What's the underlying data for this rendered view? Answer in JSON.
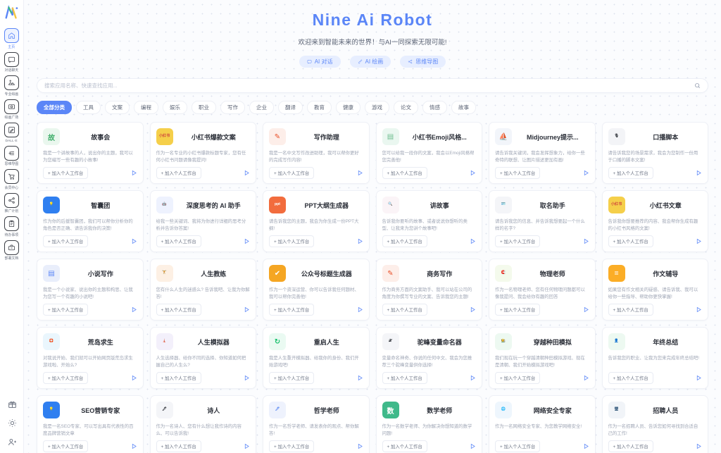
{
  "sidebar": {
    "logo": "nine-ai-logo",
    "items": [
      {
        "label": "主页",
        "icon": "home-icon",
        "active": true
      },
      {
        "label": "对话聊天",
        "icon": "chat-icon",
        "active": false
      },
      {
        "label": "专业绘画",
        "icon": "image-icon",
        "active": false
      },
      {
        "label": "绘画广场",
        "icon": "gallery-icon",
        "active": false
      },
      {
        "label": "DALL·E",
        "icon": "dalle-icon",
        "active": false
      },
      {
        "label": "思维导图",
        "icon": "mindmap-icon",
        "active": false
      },
      {
        "label": "会员中心",
        "icon": "cart-icon",
        "active": false
      },
      {
        "label": "推广计划",
        "icon": "share-icon",
        "active": false
      },
      {
        "label": "待办事项",
        "icon": "clipboard-icon",
        "active": false
      },
      {
        "label": "部署文档",
        "icon": "briefcase-icon",
        "active": false
      }
    ],
    "bottom": [
      {
        "icon": "gift-icon"
      },
      {
        "icon": "sun-icon"
      },
      {
        "icon": "user-add-icon"
      }
    ]
  },
  "hero": {
    "title": "Nine Ai Robot",
    "subtitle": "欢迎来到智能未来的世界！与AI一同探索无限可能!",
    "pills": [
      {
        "label": "AI 对话",
        "icon": "chat-bubble-icon"
      },
      {
        "label": "AI 绘画",
        "icon": "brush-icon"
      },
      {
        "label": "思维导图",
        "icon": "share-nodes-icon"
      }
    ]
  },
  "search": {
    "placeholder": "搜索应用名称、快速查找应用...",
    "value": "",
    "icon": "search-icon"
  },
  "categories": [
    {
      "label": "全部分类",
      "active": true
    },
    {
      "label": "工具",
      "active": false
    },
    {
      "label": "文案",
      "active": false
    },
    {
      "label": "编程",
      "active": false
    },
    {
      "label": "娱乐",
      "active": false
    },
    {
      "label": "职业",
      "active": false
    },
    {
      "label": "写作",
      "active": false
    },
    {
      "label": "企业",
      "active": false
    },
    {
      "label": "翻译",
      "active": false
    },
    {
      "label": "教育",
      "active": false
    },
    {
      "label": "健康",
      "active": false
    },
    {
      "label": "游戏",
      "active": false
    },
    {
      "label": "论文",
      "active": false
    },
    {
      "label": "情感",
      "active": false
    },
    {
      "label": "故事",
      "active": false
    }
  ],
  "card_actions": {
    "add_label": "+ 加入个人工作台",
    "play_icon": "play-icon"
  },
  "apps": [
    {
      "title": "故事会",
      "desc": "我是一个讲故事的人，说出你的主题，我可以为您编写一些有趣的小故事!",
      "icon": "book-icon",
      "glyph": "故",
      "fg": "#3fae6a",
      "bg": "#eaf7ee"
    },
    {
      "title": "小红书爆款文案",
      "desc": "作为一名专业的小红书爆款标题专家，您有任何小红书问题请像我提问!",
      "icon": "xiaohongshu-icon",
      "glyph": "小红书",
      "fg": "#d04a3c",
      "bg": "#f5cf4a"
    },
    {
      "title": "写作助理",
      "desc": "我是一名中文写作改进助理，我可以帮你更好的完成写作内容!",
      "icon": "pencil-doc-icon",
      "glyph": "✎",
      "fg": "#e8502a",
      "bg": "#fdeee9"
    },
    {
      "title": "小红书Emoji风格...",
      "desc": "您可以给我一段你的文案，我会以Emoji风格帮您完善他!",
      "icon": "notebook-icon",
      "glyph": "▤",
      "fg": "#6dbd8e",
      "bg": "#eaf7f0"
    },
    {
      "title": "Midjourney提示...",
      "desc": "请告诉我关键词，我会发挥想象力，给你一些奇特的联想、让图片描述更加有画!",
      "icon": "sailboat-icon",
      "glyph": "⛵",
      "fg": "#1b2a3a",
      "bg": "#f2f5fa"
    },
    {
      "title": "口播脚本",
      "desc": "请告诉我您的场景需求，我会为您制作一份用于口播的脚本文案!",
      "icon": "microphone-icon",
      "glyph": "🎙",
      "fg": "#1b1f26",
      "bg": "#f3f4f7"
    },
    {
      "title": "智囊团",
      "desc": "作为你的后援智囊团，我们可以帮你分析你的角色是否正确、请告诉我你的决策!",
      "icon": "lightbulb-icon",
      "glyph": "💡",
      "fg": "#ffffff",
      "bg": "#2f7ff0"
    },
    {
      "title": "深度思考的 AI 助手",
      "desc": "给我一些关键词、我将为你进行详细的思考分析并告诉你答案!",
      "icon": "robot-icon",
      "glyph": "🤖",
      "fg": "#3056d3",
      "bg": "#eef2fe"
    },
    {
      "title": "PPT大纲生成器",
      "desc": "请告诉我您的主题，我会为你生成一份PPT大纲!",
      "icon": "ppt-file-icon",
      "glyph": "ppt",
      "fg": "#ffffff",
      "bg": "#f26c3d"
    },
    {
      "title": "讲故事",
      "desc": "告诉我你要听的故事、或者说说你想听的类型、让我来为您讲个故事吧!",
      "icon": "magnifier-pen-icon",
      "glyph": "🔍",
      "fg": "#e8b4c8",
      "bg": "#fbf4f7"
    },
    {
      "title": "取名助手",
      "desc": "请告诉我您的信息、并告诉我想要起一个什么样的名字?",
      "icon": "id-card-icon",
      "glyph": "🪪",
      "fg": "#1b1f26",
      "bg": "#f4f5f8"
    },
    {
      "title": "小红书文章",
      "desc": "告诉我你想要推荐的内容、我会帮你生成有趣的小红书风格的文案!",
      "icon": "xiaohongshu-icon",
      "glyph": "小红书",
      "fg": "#d04a3c",
      "bg": "#f5cf4a"
    },
    {
      "title": "小说写作",
      "desc": "我是一个小说家、说出你的主题和构思、让我为您写一个有趣的小说吧!",
      "icon": "document-lines-icon",
      "glyph": "▤",
      "fg": "#5b86f7",
      "bg": "#e9eefb"
    },
    {
      "title": "人生教练",
      "desc": "您有什么人生的迷惑么? 告诉我吧、让我为你解答!",
      "icon": "coach-icon",
      "glyph": "🏋",
      "fg": "#2f7ff0",
      "bg": "#fdf0e4"
    },
    {
      "title": "公众号标题生成器",
      "desc": "作为一个资深运营、你可以告诉我任何题材、我可以帮你完善他!",
      "icon": "verified-badge-icon",
      "glyph": "✔",
      "fg": "#ffffff",
      "bg": "#f5a623"
    },
    {
      "title": "商务写作",
      "desc": "作为商务方面的文案助手、我可以站在公司的角度为你撰写专业的文案、告诉我您的主题!",
      "icon": "pencil-doc-icon",
      "glyph": "✎",
      "fg": "#e8502a",
      "bg": "#fdeee9"
    },
    {
      "title": "物理老师",
      "desc": "作为一名物理老师、您有任何物理问题都可以像我提问、我会给你有趣的回答",
      "icon": "magnet-icon",
      "glyph": "🧲",
      "fg": "#8cc63f",
      "bg": "#f4faec"
    },
    {
      "title": "作文辅导",
      "desc": "如果您有作文相关的疑惑、请告诉我、我可以给你一些指导、帮助你更快掌握!",
      "icon": "equals-circle-icon",
      "glyph": "=",
      "fg": "#ffffff",
      "bg": "#fbad26"
    },
    {
      "title": "荒岛求生",
      "desc": "对我说开始、我们就可以开始网页版荒岛求生游戏啦、开始么?",
      "icon": "lifebuoy-icon",
      "glyph": "🛟",
      "fg": "#0a9de0",
      "bg": "#eaf6fd"
    },
    {
      "title": "人生模拟器",
      "desc": "人生选择器、给你不同的选择、你知道如何把握自己的人生么?",
      "icon": "lighthouse-icon",
      "glyph": "🗼",
      "fg": "#7e5bc0",
      "bg": "#f3f0fb"
    },
    {
      "title": "重启人生",
      "desc": "我是人生重开模拟器、给我你的身份、我们开始游戏吧!",
      "icon": "restart-icon",
      "glyph": "↻",
      "fg": "#14c06a",
      "bg": "#eafaf2"
    },
    {
      "title": "驼峰变量命名器",
      "desc": "变量命名神奇、你说的任何中文、我会为您推荐三个驼峰变量供你选择!",
      "icon": "italic-x-icon",
      "glyph": "𝒳",
      "fg": "#1b1f26",
      "bg": "#f4f5f8"
    },
    {
      "title": "穿越种田模拟",
      "desc": "我们现在玩一个穿越清朝种田模拟游戏、现在是清朝、我们开始模拟游戏吧!",
      "icon": "farmer-icon",
      "glyph": "🧑‍🌾",
      "fg": "#1fa855",
      "bg": "#edf9f1"
    },
    {
      "title": "年终总结",
      "desc": "告诉我您的职业、让我为您来完成年终总结吧!",
      "icon": "person-icon",
      "glyph": "👤",
      "fg": "#1fa855",
      "bg": "#edf9f1"
    },
    {
      "title": "SEO营销专家",
      "desc": "我是一名SEO专家、可以写出具有代表性的百度品牌营销文章",
      "icon": "lightbulb-icon",
      "glyph": "💡",
      "fg": "#ffffff",
      "bg": "#2f7ff0"
    },
    {
      "title": "诗人",
      "desc": "作为一名诗人、您有什么想让我作诗的内容么、可以告诉我!",
      "icon": "poet-icon",
      "glyph": "🖋",
      "fg": "#1b1f26",
      "bg": "#f4f5f8"
    },
    {
      "title": "哲学老师",
      "desc": "作为一名哲学老师、请发表你的观点、帮你解答!",
      "icon": "feather-pen-icon",
      "glyph": "🖊",
      "fg": "#4a7cf0",
      "bg": "#eef2fd"
    },
    {
      "title": "数学老师",
      "desc": "作为一名数学老师、为你解决你想知道的数学问题!",
      "icon": "math-book-icon",
      "glyph": "数",
      "fg": "#ffffff",
      "bg": "#3fb98a"
    },
    {
      "title": "网络安全专家",
      "desc": "作为一名网络安全专家、为您教学网络安全!",
      "icon": "globe-shield-icon",
      "glyph": "🌐",
      "fg": "#2f8fe0",
      "bg": "#eef6fd"
    },
    {
      "title": "招聘人员",
      "desc": "作为一名招聘人员、告诉您如何寻找到合适自己的工作!",
      "icon": "recruit-icon",
      "glyph": "🖥",
      "fg": "#4a6b8a",
      "bg": "#f1f4f8"
    }
  ]
}
